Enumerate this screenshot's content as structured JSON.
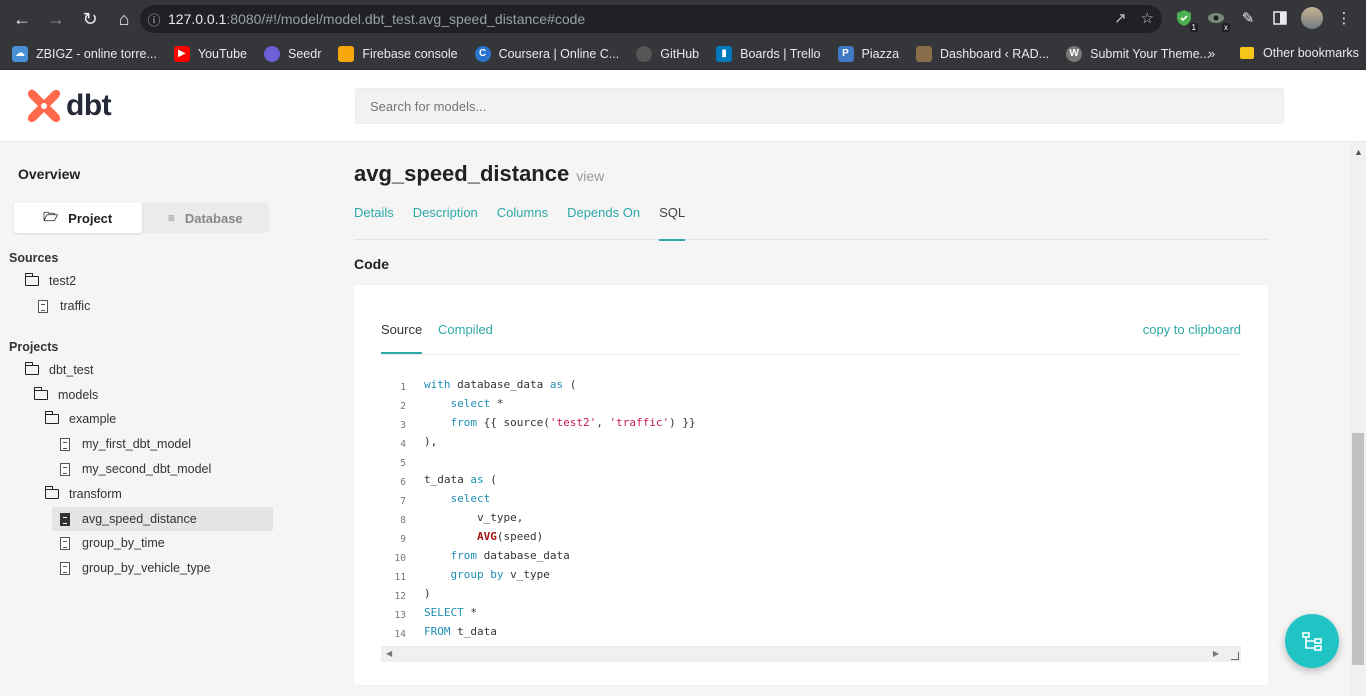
{
  "browser": {
    "url_host": "127.0.0.1",
    "url_rest": ":8080/#!/model/model.dbt_test.avg_speed_distance#code",
    "bookmarks": [
      {
        "label": "ZBIGZ - online torre...",
        "color": "#4a90d9"
      },
      {
        "label": "YouTube",
        "color": "#ff0000"
      },
      {
        "label": "Seedr",
        "color": "#6b5fd3"
      },
      {
        "label": "Firebase console",
        "color": "#f6a70a"
      },
      {
        "label": "Coursera | Online C...",
        "color": "#2a73cc"
      },
      {
        "label": "GitHub",
        "color": "#555555"
      },
      {
        "label": "Boards | Trello",
        "color": "#0079bf"
      },
      {
        "label": "Piazza",
        "color": "#3e7ac3"
      },
      {
        "label": "Dashboard ‹ RAD...",
        "color": "#8a6d4b"
      },
      {
        "label": "Submit Your Theme...",
        "color": "#777777"
      }
    ],
    "more": "»",
    "other_bookmarks": "Other bookmarks",
    "ext_badge_1": "1",
    "ext_badge_2": "x"
  },
  "header": {
    "logo_text": "dbt",
    "search_placeholder": "Search for models..."
  },
  "sidebar": {
    "overview": "Overview",
    "toggle_project": "Project",
    "toggle_database": "Database",
    "sources_label": "Sources",
    "projects_label": "Projects",
    "source_nodes": [
      "test2",
      "traffic"
    ],
    "project_nodes": [
      "dbt_test",
      "models",
      "example",
      "my_first_dbt_model",
      "my_second_dbt_model",
      "transform",
      "avg_speed_distance",
      "group_by_time",
      "group_by_vehicle_type"
    ]
  },
  "main": {
    "model_name": "avg_speed_distance",
    "model_kind": "view",
    "tabs": [
      "Details",
      "Description",
      "Columns",
      "Depends On",
      "SQL"
    ],
    "active_tab": "SQL",
    "section_label": "Code",
    "code_tabs": [
      "Source",
      "Compiled"
    ],
    "copy_label": "copy to clipboard"
  },
  "code_lines": [
    "1",
    "2",
    "3",
    "4",
    "5",
    "6",
    "7",
    "8",
    "9",
    "10",
    "11",
    "12",
    "13",
    "14"
  ],
  "colors": {
    "accent": "#2fa8a8",
    "fab": "#21c4c4",
    "logo": "#ff694b"
  }
}
